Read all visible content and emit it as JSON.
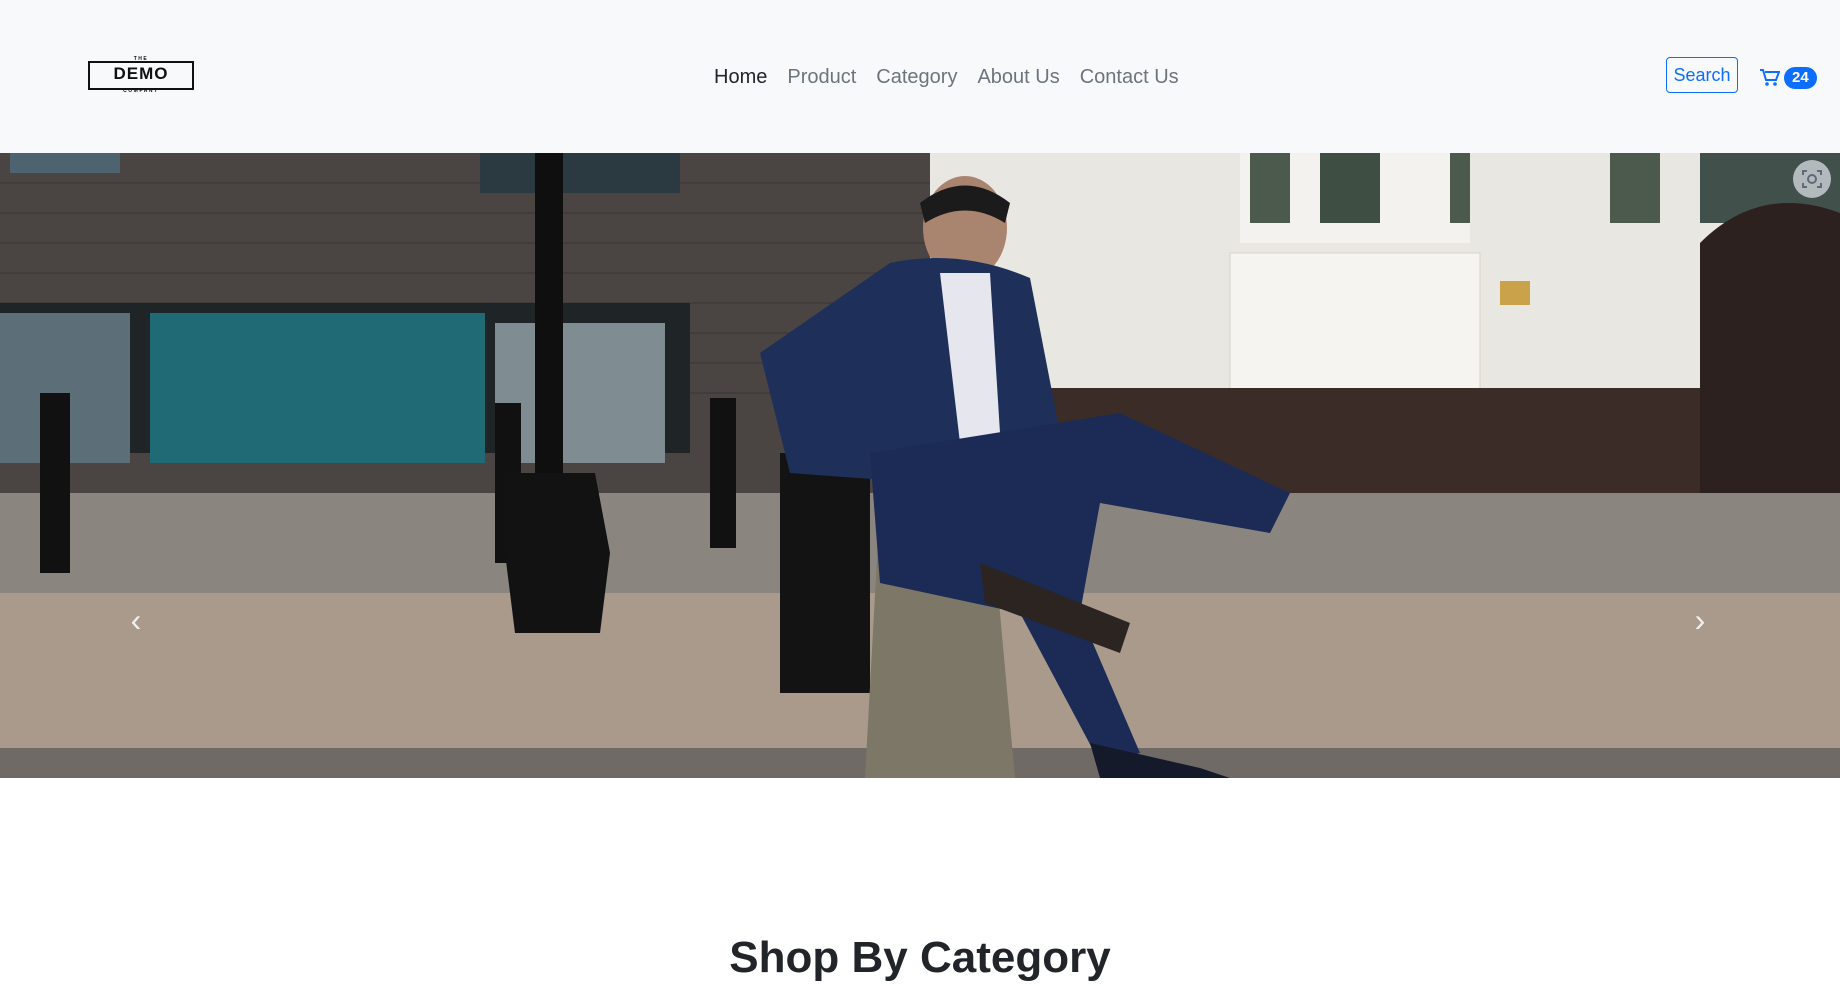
{
  "brand": {
    "logo_top": "THE",
    "logo_word": "DEMO",
    "logo_bottom": "COMPANY"
  },
  "nav": {
    "items": [
      {
        "label": "Home",
        "active": true
      },
      {
        "label": "Product",
        "active": false
      },
      {
        "label": "Category",
        "active": false
      },
      {
        "label": "About Us",
        "active": false
      },
      {
        "label": "Contact Us",
        "active": false
      }
    ]
  },
  "header": {
    "search_label": "Search",
    "cart_icon": "shopping-cart-icon",
    "cart_count": "24"
  },
  "carousel": {
    "prev_icon": "chevron-left-icon",
    "next_icon": "chevron-right-icon",
    "lens_icon": "visual-search-icon",
    "prev_glyph": "‹",
    "next_glyph": "›"
  },
  "sections": {
    "shop_by_category_title": "Shop By Category"
  },
  "colors": {
    "accent": "#0d6efd",
    "navbar_bg": "#f8f9fa"
  }
}
